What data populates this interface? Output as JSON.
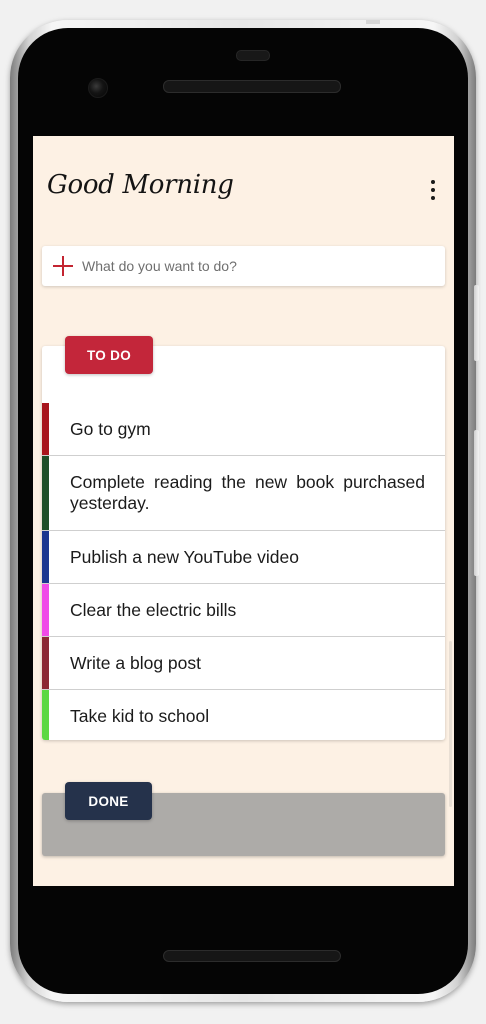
{
  "header": {
    "title": "Good Morning",
    "menu_icon": "more-vertical-icon"
  },
  "add_task": {
    "icon": "plus-icon",
    "placeholder": "What do you want to do?",
    "value": ""
  },
  "todo_section": {
    "label": "TO DO",
    "color": "#c3263a",
    "tasks": [
      {
        "text": "Go to gym",
        "color": "#a8151c"
      },
      {
        "text": "Complete reading the new book purchased yesterday.",
        "color": "#1e4e27"
      },
      {
        "text": "Publish a new YouTube video",
        "color": "#1b3690"
      },
      {
        "text": "Clear the electric bills",
        "color": "#f04ae8"
      },
      {
        "text": "Write  a blog post",
        "color": "#8b2733"
      },
      {
        "text": "Take kid to school",
        "color": "#5cd843"
      }
    ]
  },
  "done_section": {
    "label": "DONE",
    "color": "#25324b",
    "tasks": []
  },
  "theme": {
    "background": "#fdf1e4",
    "done_card": "#adaba8"
  }
}
